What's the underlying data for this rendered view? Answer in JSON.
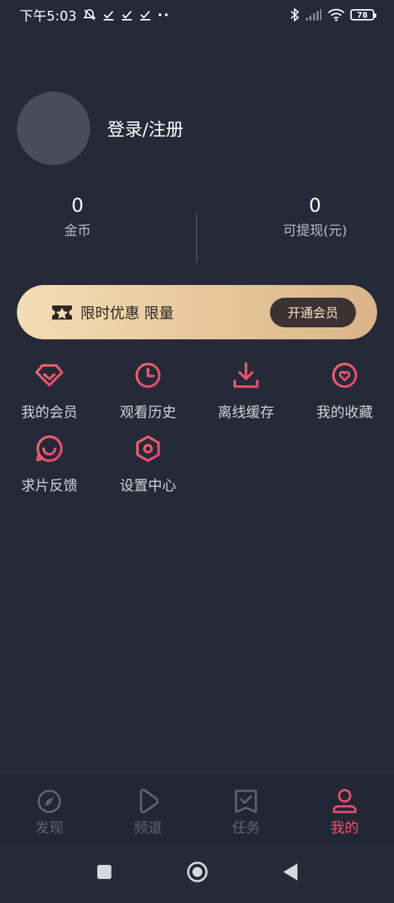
{
  "status_bar": {
    "time": "下午5:03",
    "battery": "78"
  },
  "profile": {
    "login_label": "登录/注册"
  },
  "stats": {
    "coins": {
      "value": "0",
      "label": "金币"
    },
    "cash": {
      "value": "0",
      "label": "可提现(元)"
    }
  },
  "vip_banner": {
    "text": "限时优惠 限量",
    "button_label": "开通会员"
  },
  "menu": {
    "items": [
      {
        "label": "我的会员",
        "icon": "diamond-icon"
      },
      {
        "label": "观看历史",
        "icon": "clock-icon"
      },
      {
        "label": "离线缓存",
        "icon": "download-icon"
      },
      {
        "label": "我的收藏",
        "icon": "heart-icon"
      },
      {
        "label": "求片反馈",
        "icon": "chat-smile-icon"
      },
      {
        "label": "设置中心",
        "icon": "hexagon-settings-icon"
      }
    ]
  },
  "tabbar": {
    "tabs": [
      {
        "label": "发现",
        "icon": "compass-icon",
        "active": false
      },
      {
        "label": "频道",
        "icon": "play-icon",
        "active": false
      },
      {
        "label": "任务",
        "icon": "task-check-icon",
        "active": false
      },
      {
        "label": "我的",
        "icon": "user-icon",
        "active": true
      }
    ]
  },
  "colors": {
    "background": "#262a38",
    "accent": "#f0506e",
    "inactive_tab": "#5f6373",
    "banner_gold": "#e7c79c"
  }
}
